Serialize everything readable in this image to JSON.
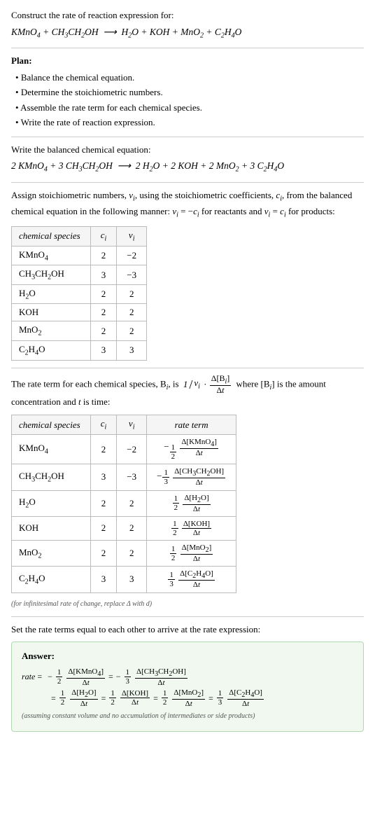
{
  "header": {
    "title": "Construct the rate of reaction expression for:",
    "reaction": "KMnO₄ + CH₃CH₂OH ⟶ H₂O + KOH + MnO₂ + C₂H₄O"
  },
  "plan": {
    "title": "Plan:",
    "items": [
      "Balance the chemical equation.",
      "Determine the stoichiometric numbers.",
      "Assemble the rate term for each chemical species.",
      "Write the rate of reaction expression."
    ]
  },
  "balanced": {
    "intro": "Write the balanced chemical equation:",
    "equation": "2 KMnO₄ + 3 CH₃CH₂OH ⟶ 2 H₂O + 2 KOH + 2 MnO₂ + 3 C₂H₄O"
  },
  "stoichio": {
    "intro": "Assign stoichiometric numbers, νᵢ, using the stoichiometric coefficients, cᵢ, from the balanced chemical equation in the following manner: νᵢ = −cᵢ for reactants and νᵢ = cᵢ for products:",
    "table_headers": [
      "chemical species",
      "cᵢ",
      "νᵢ"
    ],
    "rows": [
      {
        "species": "KMnO₄",
        "c": "2",
        "v": "−2"
      },
      {
        "species": "CH₃CH₂OH",
        "c": "3",
        "v": "−3"
      },
      {
        "species": "H₂O",
        "c": "2",
        "v": "2"
      },
      {
        "species": "KOH",
        "c": "2",
        "v": "2"
      },
      {
        "species": "MnO₂",
        "c": "2",
        "v": "2"
      },
      {
        "species": "C₂H₄O",
        "c": "3",
        "v": "3"
      }
    ]
  },
  "rate_terms": {
    "intro": "The rate term for each chemical species, Bᵢ, is 1/νᵢ · Δ[Bᵢ]/Δt where [Bᵢ] is the amount concentration and t is time:",
    "table_headers": [
      "chemical species",
      "cᵢ",
      "νᵢ",
      "rate term"
    ],
    "rows": [
      {
        "species": "KMnO₄",
        "c": "2",
        "v": "−2",
        "rate": "−1/2 · Δ[KMnO₄]/Δt"
      },
      {
        "species": "CH₃CH₂OH",
        "c": "3",
        "v": "−3",
        "rate": "−1/3 · Δ[CH₃CH₂OH]/Δt"
      },
      {
        "species": "H₂O",
        "c": "2",
        "v": "2",
        "rate": "1/2 · Δ[H₂O]/Δt"
      },
      {
        "species": "KOH",
        "c": "2",
        "v": "2",
        "rate": "1/2 · Δ[KOH]/Δt"
      },
      {
        "species": "MnO₂",
        "c": "2",
        "v": "2",
        "rate": "1/2 · Δ[MnO₂]/Δt"
      },
      {
        "species": "C₂H₄O",
        "c": "3",
        "v": "3",
        "rate": "1/3 · Δ[C₂H₄O]/Δt"
      }
    ],
    "note": "(for infinitesimal rate of change, replace Δ with d)"
  },
  "answer": {
    "set_intro": "Set the rate terms equal to each other to arrive at the rate expression:",
    "title": "Answer:",
    "label": "rate",
    "disclaimer": "(assuming constant volume and no accumulation of intermediates or side products)"
  },
  "colors": {
    "answer_bg": "#f0f8f0",
    "answer_border": "#b0d8b0"
  }
}
